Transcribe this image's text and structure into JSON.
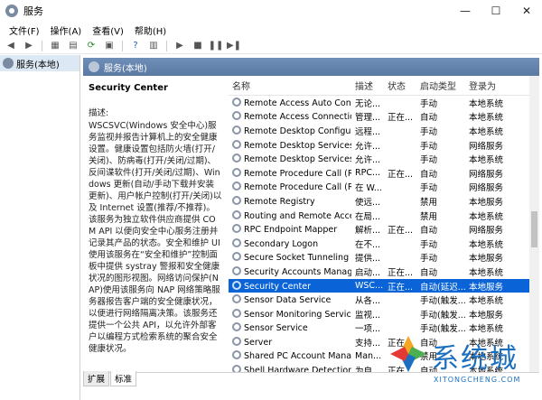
{
  "window": {
    "title": "服务",
    "controls": {
      "minimize": "—",
      "maximize": "☐",
      "close": "✕"
    }
  },
  "menu": [
    "文件(F)",
    "操作(A)",
    "查看(V)",
    "帮助(H)"
  ],
  "toolbar": {
    "buttons": [
      "back-arrow-icon",
      "forward-arrow-icon",
      "console-tree-icon",
      "properties-icon",
      "refresh-icon",
      "export-icon",
      "help-icon",
      "toolbar-panel-icon",
      "play-icon",
      "stop-icon",
      "pause-icon",
      "restart-icon"
    ]
  },
  "tree": {
    "root_label": "服务(本地)"
  },
  "panel": {
    "header": "服务(本地)"
  },
  "detail": {
    "service_name": "Security Center",
    "desc_label": "描述:",
    "description": "WSCSVC(Windows 安全中心)服务监视并报告计算机上的安全健康设置。健康设置包括防火墙(打开/关闭)、防病毒(打开/关闭/过期)、反间谍软件(打开/关闭/过期)、Windows 更新(自动/手动下载并安装更新)、用户帐户控制(打开/关闭)以及 Internet 设置(推荐/不推荐)。该服务为独立软件供应商提供 COM API 以便向安全中心服务注册并记录其产品的状态。安全和维护 UI 使用该服务在“安全和维护”控制面板中提供 systray 警报和安全健康状况的图形视图。网络访问保护(NAP)使用该服务向 NAP 网络策略服务器报告客户端的安全健康状况，以便进行网络隔离决策。该服务还提供一个公共 API，以允许外部客户以编程方式检索系统的聚合安全健康状况。"
  },
  "list": {
    "columns": [
      "名称",
      "描述",
      "状态",
      "启动类型",
      "登录为"
    ],
    "rows": [
      {
        "name": "Remote Access Auto Conn...",
        "desc": "无论...",
        "status": "",
        "startup": "手动",
        "logon": "本地系统"
      },
      {
        "name": "Remote Access Connectio...",
        "desc": "管理...",
        "status": "正在...",
        "startup": "自动",
        "logon": "本地系统"
      },
      {
        "name": "Remote Desktop Configur...",
        "desc": "远程...",
        "status": "",
        "startup": "手动",
        "logon": "本地系统"
      },
      {
        "name": "Remote Desktop Services",
        "desc": "允许...",
        "status": "",
        "startup": "手动",
        "logon": "网络服务"
      },
      {
        "name": "Remote Desktop Services ...",
        "desc": "允许...",
        "status": "",
        "startup": "手动",
        "logon": "本地系统"
      },
      {
        "name": "Remote Procedure Call (R...",
        "desc": "RPC...",
        "status": "正在...",
        "startup": "自动",
        "logon": "网络服务"
      },
      {
        "name": "Remote Procedure Call (R...",
        "desc": "在 W...",
        "status": "",
        "startup": "手动",
        "logon": "网络服务"
      },
      {
        "name": "Remote Registry",
        "desc": "使远...",
        "status": "",
        "startup": "禁用",
        "logon": "本地服务"
      },
      {
        "name": "Routing and Remote Access",
        "desc": "在局...",
        "status": "",
        "startup": "禁用",
        "logon": "本地系统"
      },
      {
        "name": "RPC Endpoint Mapper",
        "desc": "解析...",
        "status": "正在...",
        "startup": "自动",
        "logon": "网络服务"
      },
      {
        "name": "Secondary Logon",
        "desc": "在不...",
        "status": "",
        "startup": "手动",
        "logon": "本地系统"
      },
      {
        "name": "Secure Socket Tunneling P...",
        "desc": "提供...",
        "status": "",
        "startup": "手动",
        "logon": "本地服务"
      },
      {
        "name": "Security Accounts Manager",
        "desc": "启动...",
        "status": "正在...",
        "startup": "自动",
        "logon": "本地系统"
      },
      {
        "name": "Security Center",
        "desc": "WSC...",
        "status": "正在...",
        "startup": "自动(延迟...",
        "logon": "本地服务"
      },
      {
        "name": "Sensor Data Service",
        "desc": "从各...",
        "status": "",
        "startup": "手动(触发...",
        "logon": "本地系统"
      },
      {
        "name": "Sensor Monitoring Service",
        "desc": "监视...",
        "status": "",
        "startup": "手动(触发...",
        "logon": "本地服务"
      },
      {
        "name": "Sensor Service",
        "desc": "一项...",
        "status": "",
        "startup": "手动(触发...",
        "logon": "本地系统"
      },
      {
        "name": "Server",
        "desc": "支持...",
        "status": "正在...",
        "startup": "自动",
        "logon": "本地系统"
      },
      {
        "name": "Shared PC Account Manager",
        "desc": "Man...",
        "status": "",
        "startup": "禁用",
        "logon": "本地系统"
      },
      {
        "name": "Shell Hardware Detection",
        "desc": "为自...",
        "status": "正在...",
        "startup": "自动",
        "logon": "本地系统"
      }
    ],
    "selected_index": 13
  },
  "tabs": [
    "扩展",
    "标准"
  ],
  "watermark": {
    "text": "系统城",
    "sub": "XITONGCHENG.COM"
  },
  "colors": {
    "selection": "#0a64d8",
    "header_bar": "#5a7aa3",
    "watermark": "#1a6fc0"
  }
}
